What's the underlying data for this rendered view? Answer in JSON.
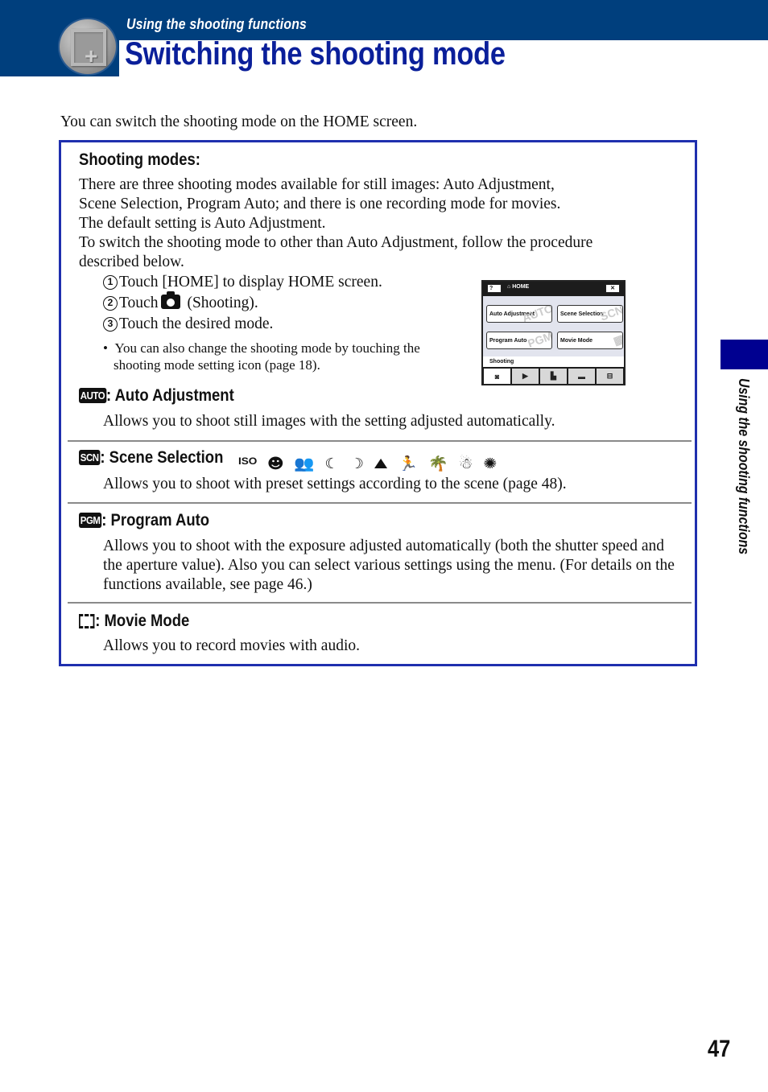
{
  "header": {
    "section_label": "Using the shooting functions",
    "title": "Switching the shooting mode",
    "logo_icon": "camera-plus-icon"
  },
  "intro": "You can switch the shooting mode on the HOME screen.",
  "shooting_modes": {
    "heading": "Shooting modes:",
    "paragraph_lines": [
      "There are three shooting modes available for still images: Auto Adjustment,",
      "Scene Selection, Program Auto; and there is one recording mode for movies.",
      "The default setting is Auto Adjustment.",
      "To switch the shooting mode to other than Auto Adjustment, follow the procedure",
      "described below."
    ],
    "steps": [
      {
        "num": "1",
        "text": "Touch [HOME] to display HOME screen."
      },
      {
        "num": "2",
        "text_before": "Touch",
        "icon": "camera-icon",
        "text_after": "(Shooting)."
      },
      {
        "num": "3",
        "text": "Touch the desired mode."
      }
    ],
    "note_lines": [
      "You can also change the shooting mode by touching the",
      "shooting mode setting icon (page 18)."
    ]
  },
  "home_screen": {
    "help_label": "?",
    "home_label": "HOME",
    "close_label": "✕",
    "modes": [
      {
        "label": "Auto Adjustment",
        "watermark": "AUTO"
      },
      {
        "label": "Scene Selection",
        "watermark": "SCN"
      },
      {
        "label": "Program Auto",
        "watermark": "PGM"
      },
      {
        "label": "Movie Mode",
        "watermark": "▦"
      }
    ],
    "category_label": "Shooting",
    "tabs": [
      "shooting-tab-icon",
      "playback-tab-icon",
      "print-tab-icon",
      "slideshow-tab-icon",
      "settings-tab-icon"
    ]
  },
  "modes": [
    {
      "badge": "AUTO",
      "name": ": Auto Adjustment",
      "desc_lines": [
        "Allows you to shoot still images with the setting adjusted automatically."
      ]
    },
    {
      "badge": "SCN",
      "name": ": Scene Selection",
      "scene_icons": [
        "high-sensitivity-icon",
        "smile-shutter-icon",
        "soft-snap-icon",
        "twilight-portrait-icon",
        "twilight-icon",
        "landscape-icon",
        "advanced-sports-icon",
        "beach-icon",
        "snow-icon",
        "fireworks-icon"
      ],
      "desc_lines": [
        "Allows you to shoot with preset settings according to the scene (page 48)."
      ]
    },
    {
      "badge": "PGM",
      "name": ": Program Auto",
      "desc_lines": [
        "Allows you to shoot with the exposure adjusted automatically (both the shutter speed and",
        "the aperture value). Also you can select various settings using the menu. (For details on the",
        "functions available, see page 46.)"
      ]
    },
    {
      "badge": "movie",
      "name": ": Movie Mode",
      "desc_lines": [
        "Allows you to record movies with audio."
      ]
    }
  ],
  "side_tab": "Using the shooting functions",
  "page_number": "47"
}
